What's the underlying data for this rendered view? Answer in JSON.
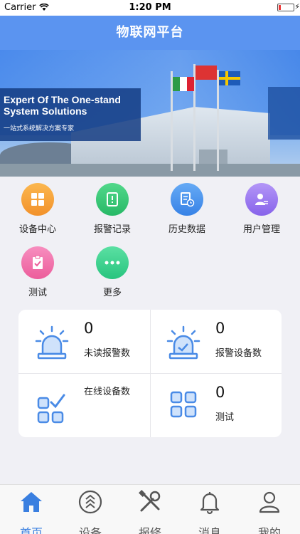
{
  "status_bar": {
    "carrier": "Carrier",
    "time": "1:20 PM"
  },
  "header": {
    "title": "物联网平台"
  },
  "banner": {
    "headline_line1": "Expert Of The One-stand",
    "headline_line2": "System Solutions",
    "subtitle": "一站式系统解决方案专家"
  },
  "menu": [
    {
      "label": "设备中心",
      "icon": "grid-icon",
      "color": "#f7a23a"
    },
    {
      "label": "报警记录",
      "icon": "alarm-book-icon",
      "color": "#3cc97a"
    },
    {
      "label": "历史数据",
      "icon": "history-doc-icon",
      "color": "#4a96ef"
    },
    {
      "label": "用户管理",
      "icon": "user-manage-icon",
      "color": "#9b7cf0"
    },
    {
      "label": "测试",
      "icon": "clipboard-check-icon",
      "color": "#f26fa7"
    },
    {
      "label": "更多",
      "icon": "more-dots-icon",
      "color": "#36d08c"
    }
  ],
  "stats": {
    "unread_alarms": {
      "value": "0",
      "label": "未读报警数"
    },
    "alarm_devices": {
      "value": "0",
      "label": "报警设备数"
    },
    "online_devices": {
      "value": "",
      "label": "在线设备数"
    },
    "test": {
      "value": "0",
      "label": "测试"
    }
  },
  "tabs": [
    {
      "label": "首页",
      "icon": "home-icon",
      "active": true
    },
    {
      "label": "设备",
      "icon": "device-icon",
      "active": false
    },
    {
      "label": "报修",
      "icon": "repair-tools-icon",
      "active": false
    },
    {
      "label": "消息",
      "icon": "bell-icon",
      "active": false
    },
    {
      "label": "我的",
      "icon": "profile-icon",
      "active": false
    }
  ],
  "colors": {
    "primary": "#5b94f0",
    "active_tab": "#3a7fe0",
    "stat_icon": "#4a8be6"
  }
}
